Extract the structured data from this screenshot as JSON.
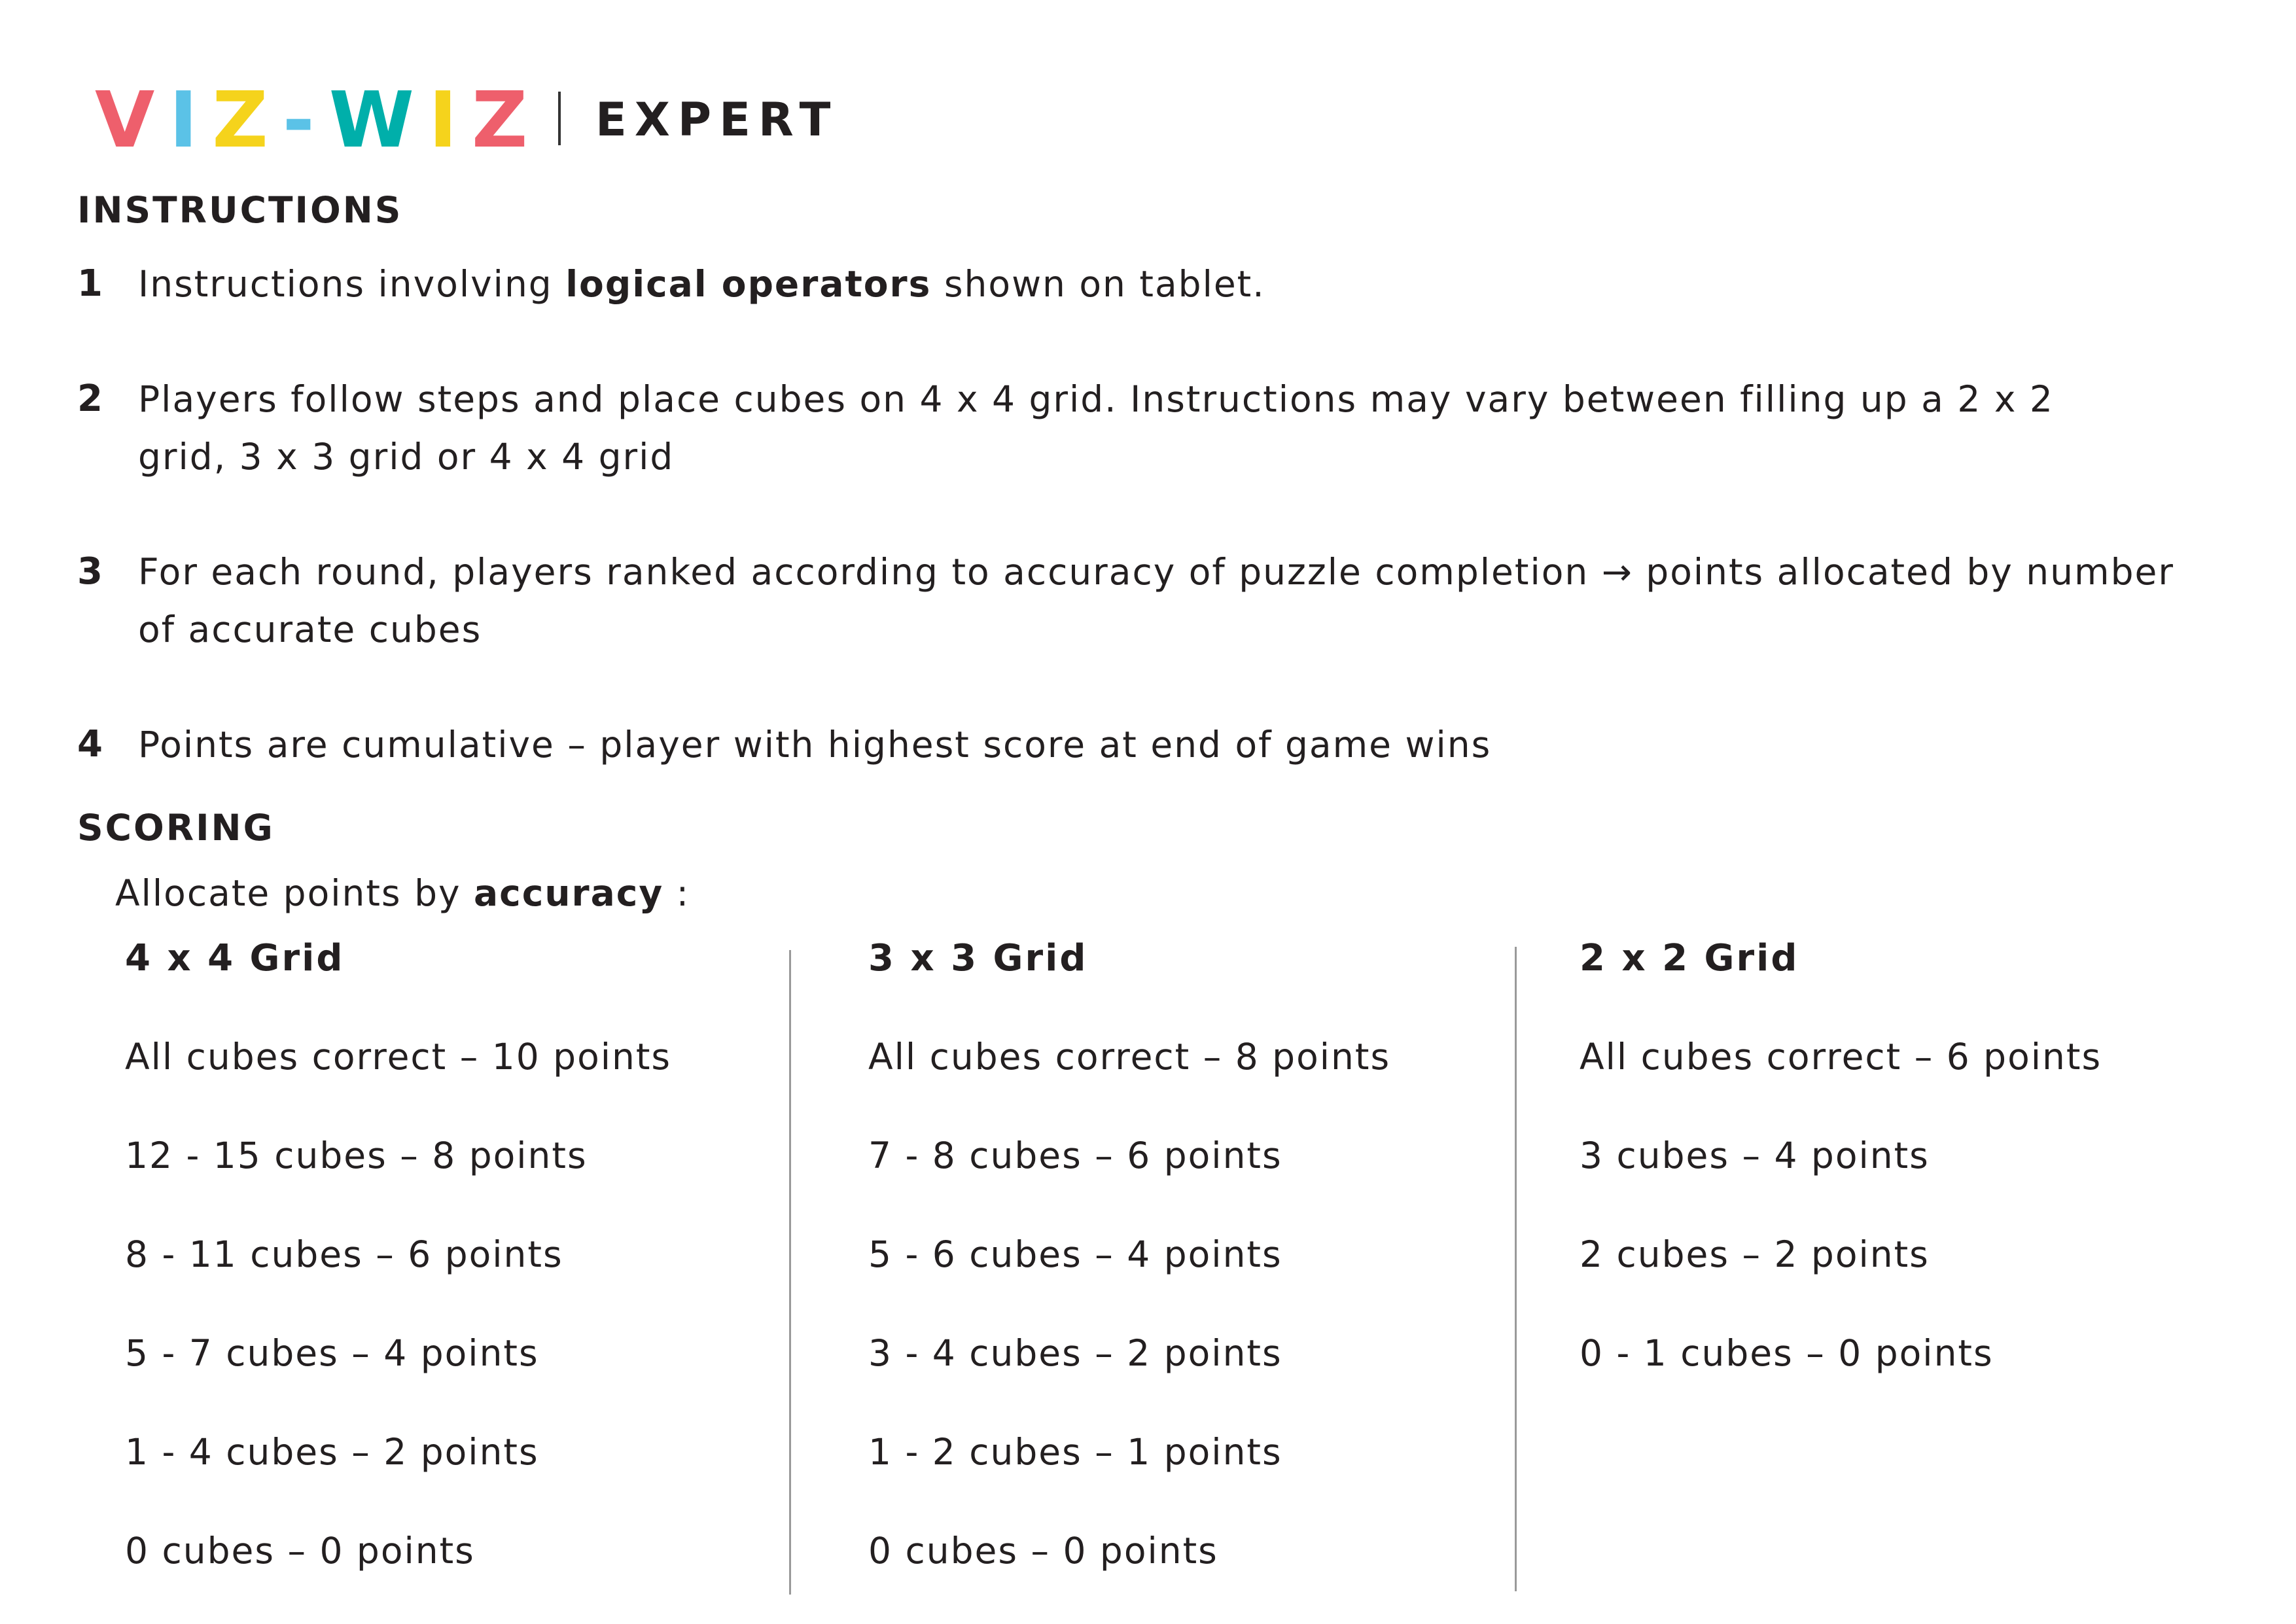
{
  "header": {
    "logo_letters": [
      {
        "char": "V",
        "color": "#ee5f6c"
      },
      {
        "char": "I",
        "color": "#5bc2e7"
      },
      {
        "char": "Z",
        "color": "#f5d31c"
      },
      {
        "char": "-",
        "color": "#5bc2e7"
      },
      {
        "char": "W",
        "color": "#00afaa"
      },
      {
        "char": "I",
        "color": "#f5d31c"
      },
      {
        "char": "Z",
        "color": "#ee5f6c"
      }
    ],
    "level": "EXPERT"
  },
  "instructions": {
    "heading": "INSTRUCTIONS",
    "steps": [
      {
        "number": "1",
        "text_before": "Instructions involving ",
        "bold": "logical operators",
        "text_after": " shown on tablet."
      },
      {
        "number": "2",
        "text_before": "Players follow steps and place cubes on 4 x 4 grid. Instructions may vary between filling up a 2 x 2 grid, 3 x 3 grid or 4 x 4 grid",
        "bold": "",
        "text_after": ""
      },
      {
        "number": "3",
        "text_before": "For each round, players ranked according to accuracy of puzzle completion → points allocated by number of accurate cubes",
        "bold": "",
        "text_after": ""
      },
      {
        "number": "4",
        "text_before": "Points are cumulative – player with highest score at end of game wins",
        "bold": "",
        "text_after": ""
      }
    ]
  },
  "scoring": {
    "heading": "SCORING",
    "allocate_prefix": "Allocate points by ",
    "allocate_bold": "accuracy",
    "allocate_suffix": " :",
    "columns": [
      {
        "title": "4 x 4 Grid",
        "rows": [
          "All cubes correct  –   10 points",
          "12 - 15 cubes  –  8 points",
          "8 - 11 cubes  –  6 points",
          "5 - 7 cubes  –  4 points",
          "1 - 4 cubes  –  2 points",
          "0 cubes  – 0 points"
        ]
      },
      {
        "title": "3 x 3 Grid",
        "rows": [
          "All cubes correct  –  8 points",
          "7 - 8 cubes  –  6 points",
          "5 - 6 cubes  –  4 points",
          "3 - 4 cubes  –  2 points",
          "1 - 2 cubes  –  1 points",
          "0 cubes  –  0 points"
        ]
      },
      {
        "title": "2 x 2 Grid",
        "rows": [
          "All cubes correct  –   6 points",
          "3 cubes  –  4 points",
          "2 cubes  –  2 points",
          "0 - 1 cubes  –  0 points"
        ]
      }
    ]
  }
}
